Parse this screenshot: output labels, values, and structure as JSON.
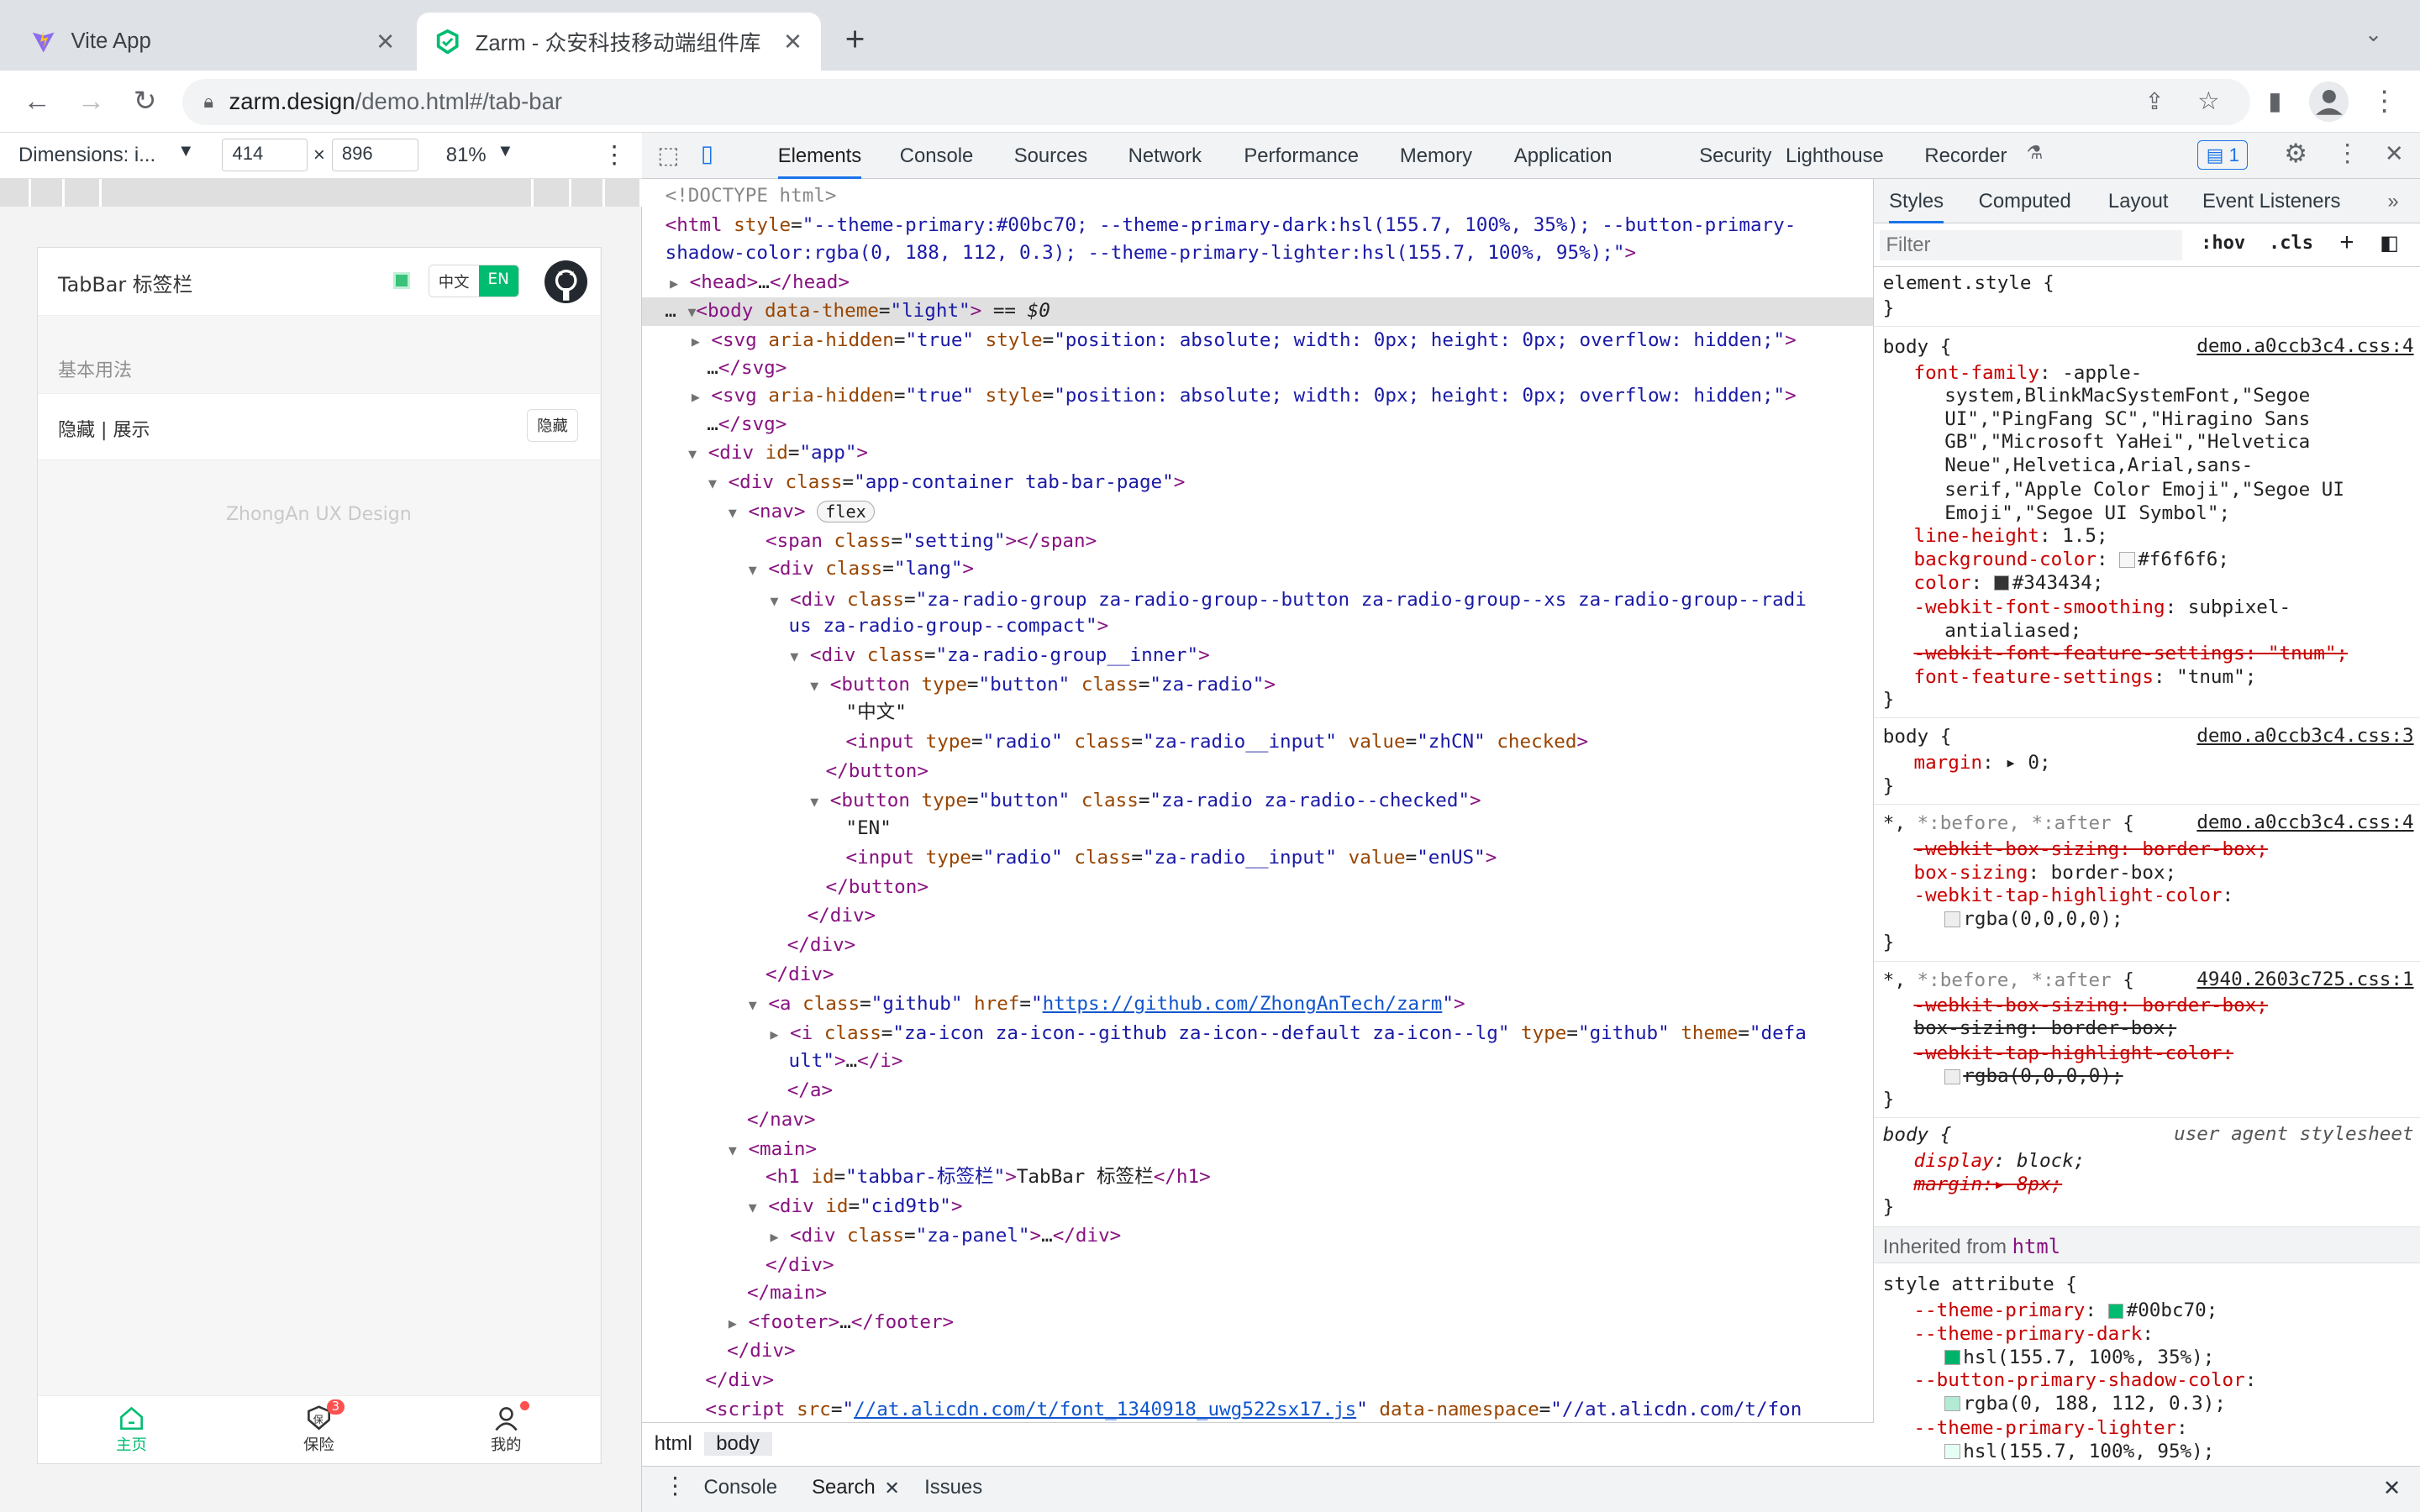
{
  "browser": {
    "tabs": [
      {
        "title": "Vite App",
        "icon": "vite-logo-icon"
      },
      {
        "title": "Zarm - 众安科技移动端组件库",
        "icon": "zarm-logo-icon",
        "active": true
      }
    ],
    "url_host": "zarm.design",
    "url_path": "/demo.html#/tab-bar"
  },
  "device_toolbar": {
    "dimensions_label": "Dimensions: i...",
    "width": "414",
    "times": "×",
    "height": "896",
    "zoom": "81%"
  },
  "phone": {
    "title": "TabBar 标签栏",
    "lang_options": [
      "中文",
      "EN"
    ],
    "lang_selected": "EN",
    "section_title": "基本用法",
    "panel_label": "隐藏 | 展示",
    "panel_button": "隐藏",
    "footer": "ZhongAn UX Design",
    "tabbar": [
      {
        "label": "主页",
        "icon": "home-icon",
        "active": true
      },
      {
        "label": "保险",
        "icon": "insurance-icon",
        "badge": "3"
      },
      {
        "label": "我的",
        "icon": "user-icon",
        "dot": true
      }
    ],
    "accent": "#00bc70"
  },
  "devtools": {
    "tabs": [
      "Elements",
      "Console",
      "Sources",
      "Network",
      "Performance",
      "Memory",
      "Application",
      "Security",
      "Lighthouse",
      "Recorder"
    ],
    "active_tab": "Elements",
    "issues_count": "1",
    "breadcrumb": [
      "html",
      "body"
    ],
    "drawer_tabs": [
      "Console",
      "Search",
      "Issues"
    ],
    "styles_tabs": [
      "Styles",
      "Computed",
      "Layout",
      "Event Listeners"
    ],
    "filter_placeholder": "Filter",
    "hov": ":hov",
    "cls": ".cls",
    "inherited_label": "Inherited from",
    "inherited_from": "html"
  }
}
